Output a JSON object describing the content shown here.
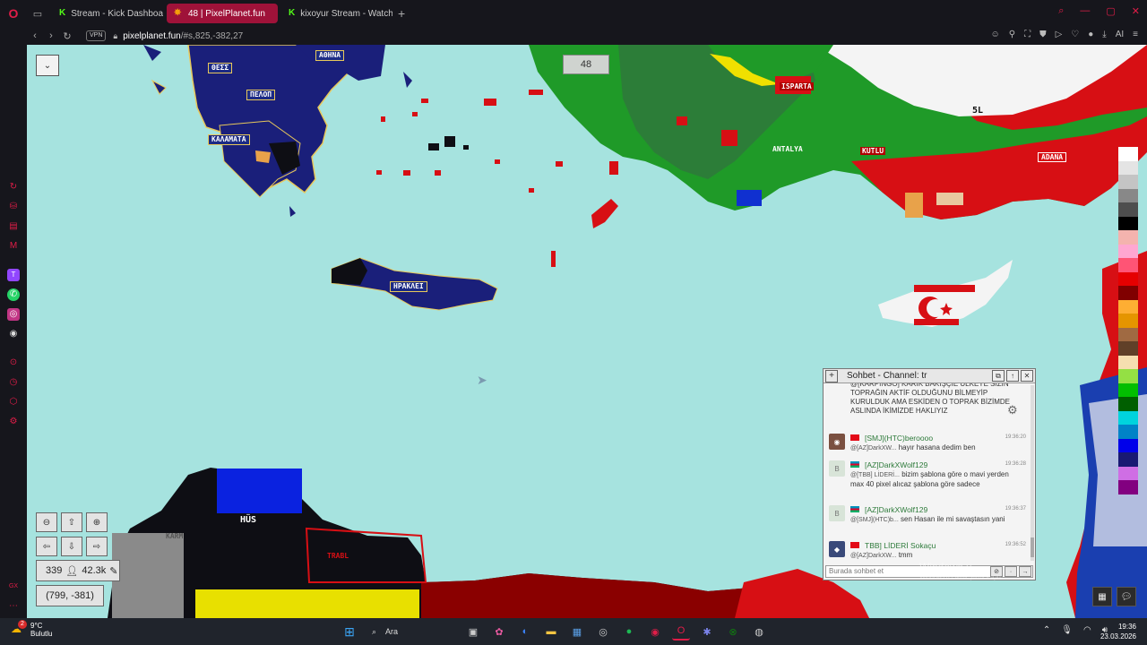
{
  "browser": {
    "tabs": [
      {
        "label": "Stream - Kick Dashboard",
        "favicon": "K",
        "active": false
      },
      {
        "label": "48 | PixelPlanet.fun",
        "favicon": "pixelplanet-icon",
        "active": true
      },
      {
        "label": "kixoyur Stream - Watch Live",
        "favicon": "K",
        "active": false
      }
    ],
    "vpn_label": "VPN",
    "url_domain": "pixelplanet.fun",
    "url_path": "/#s,825,-382,27",
    "ai_label": "AI"
  },
  "map": {
    "menu_toggle": "⌄",
    "online_count": "48",
    "zoom_in": "⊕",
    "zoom_out": "⊖",
    "arrows": {
      "up": "⇧",
      "down": "⇩",
      "left": "⇦",
      "right": "⇨"
    },
    "user_count": "339",
    "pixel_count": "42.3k",
    "coordinates": "(799, -381)",
    "labels": {
      "l1": "ΘΕΣΣ",
      "l2": "ΑΘΗΝΑ",
      "l3": "ΠΕΛΟΠ",
      "l4": "ΚΑΛΑΜΑΤΑ",
      "l5": "ΗΡΑΚΛΕΙ",
      "isparta": "ISPARTA",
      "antalya": "ANTALYA",
      "kutlu": "KUTLU",
      "adana": "ADANA",
      "hus": "HÜS",
      "sl": "5L",
      "karm": "KARM",
      "trabl": "TRABL"
    },
    "palette": [
      "#ffffff",
      "#e4e4e4",
      "#c4c4c4",
      "#888888",
      "#4e4e4e",
      "#000000",
      "#f4b3ae",
      "#ffa7d1",
      "#ff5475",
      "#e50000",
      "#800000",
      "#feae33",
      "#e59500",
      "#a06a42",
      "#604028",
      "#f5dfb0",
      "#94e044",
      "#02be01",
      "#005f00",
      "#00d3dd",
      "#0083c7",
      "#0000ea",
      "#191973",
      "#cf6ee4",
      "#820080"
    ],
    "colors": {
      "sea": "#a6e3df",
      "greek_blue": "#1a1f7a",
      "turkey_green": "#1f9a28",
      "red": "#d70f14"
    }
  },
  "chat": {
    "title": "Sohbet - Channel: tr",
    "system_text": "@[KARPINGO] KARIK BAKIŞÇIE ÜLKEYE SİZİN TOPRAĞIN AKTİF OLDUĞUNU BİLMEYİP KURULDUK AMA ESKİDEN O TOPRAK BİZİMDE ASLINDA İKİMİZDE HAKLIYIZ",
    "messages": [
      {
        "avatar": "",
        "name": "[SMJ](HTC)beroooo",
        "time": "19:36:20",
        "mention": "@[AZ]DarkXW...",
        "text": "hayır hasana dedim ben"
      },
      {
        "avatar": "B",
        "name": "[AZ]DarkXWolf129",
        "time": "19:36:28",
        "mention": "@[TBB] LİDERİ...",
        "text": "bizim şablona göre o mavi yerden max 40 pixel alıcaz şablona göre sadece"
      },
      {
        "avatar": "B",
        "name": "[AZ]DarkXWolf129",
        "time": "19:36:37",
        "mention": "@[SMJ](HTC)b...",
        "text": "sen Hasan ile mi savaştasın yani"
      },
      {
        "avatar": "",
        "name": "TBB] LİDERİ Sokaçu",
        "time": "19:36:52",
        "mention": "@[AZ]DarkXW...",
        "text": "tmm"
      }
    ],
    "input_placeholder": "Burada sohbet et",
    "watermark": "Windows u",
    "watermark_sub": "Windows'u etkinleştirmek için"
  },
  "taskbar": {
    "weather_temp": "9°C",
    "weather_desc": "Bulutlu",
    "notification_count": "2",
    "search_placeholder": "Ara",
    "time": "19:36",
    "date": "23.03.2026"
  }
}
